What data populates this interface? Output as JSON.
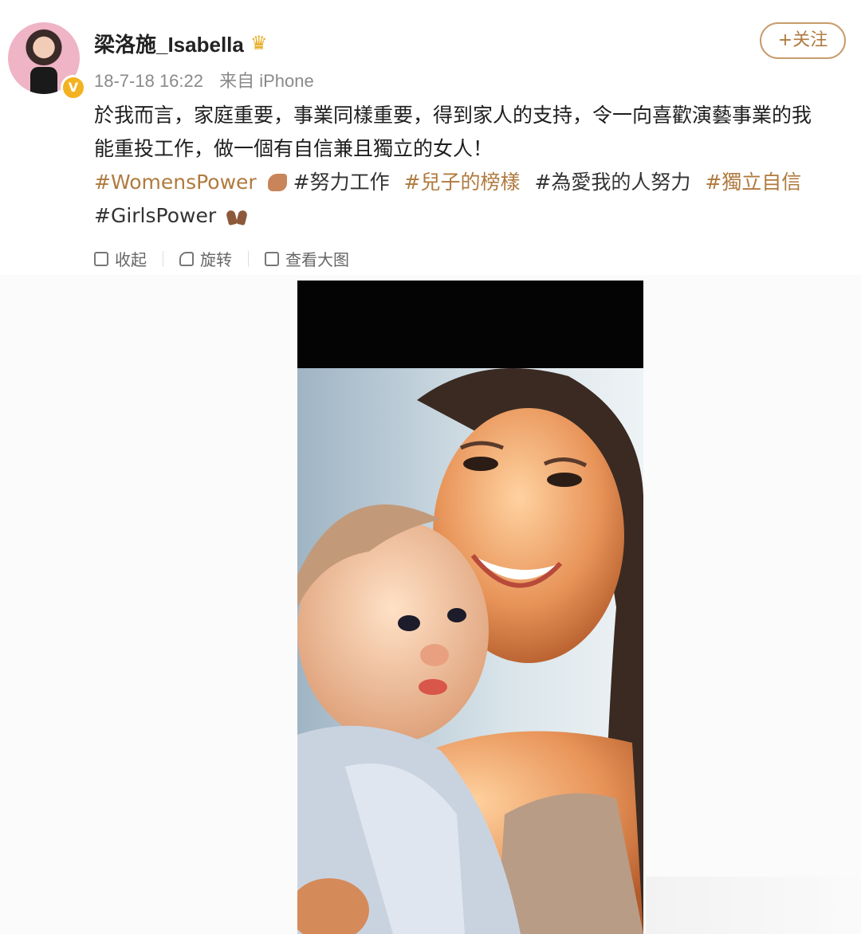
{
  "user": {
    "name": "梁洛施_Isabella",
    "timestamp": "18-7-18 16:22",
    "source": "来自 iPhone",
    "verified_mark": "V"
  },
  "follow_button": {
    "label": "+关注"
  },
  "post": {
    "line1": "於我而言，家庭重要，事業同樣重要，得到家人的支持，令一向喜歡演藝事業的我",
    "line2": "能重投工作，做一個有自信兼且獨立的女人！",
    "tags": [
      "#WomensPower",
      "#努力工作",
      "#兒子的榜樣",
      "#為愛我的人努力",
      "#獨立自信",
      "#GirlsPower"
    ]
  },
  "actions": {
    "collapse": "收起",
    "rotate": "旋转",
    "view_large": "查看大图"
  },
  "colors": {
    "tag": "#b07a3f",
    "follow_border": "#c89b6b"
  }
}
